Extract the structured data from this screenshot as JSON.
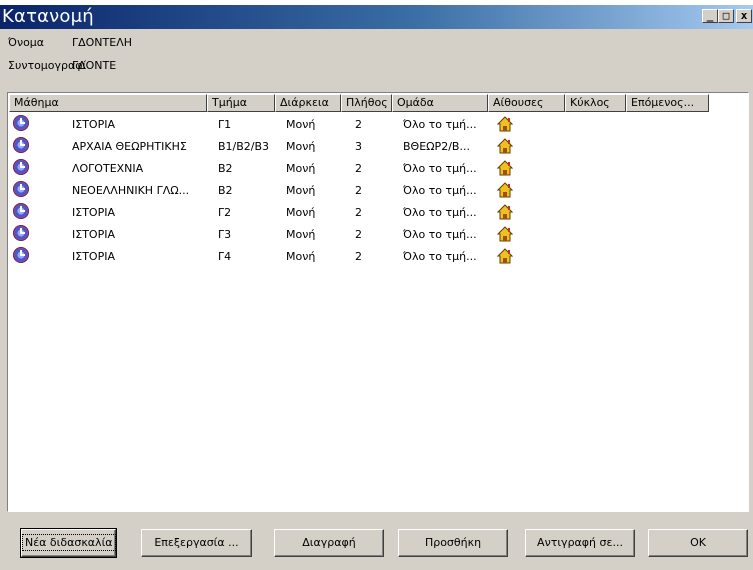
{
  "window": {
    "title": "Κατανομή",
    "controls": [
      "_",
      "□",
      "x"
    ]
  },
  "info": {
    "name_label": "Όνομα",
    "name_value": "ΓΔΟΝΤΕΛΗ",
    "abbr_label": "Συντομογραφί",
    "abbr_value": "ΓΔΟΝΤΕ"
  },
  "columns": [
    "Μάθημα",
    "Τμήμα",
    "Διάρκεια",
    "Πλήθος",
    "Ομάδα",
    "Αίθουσες",
    "Κύκλος",
    "Επόμενος..."
  ],
  "rows": [
    {
      "subject": "ΙΣΤΟΡΙΑ",
      "section": "Γ1",
      "duration": "Μονή",
      "count": "2",
      "group": "Όλο το τμή..."
    },
    {
      "subject": "ΑΡΧΑΙΑ ΘΕΩΡΗΤΙΚΗΣ",
      "section": "Β1/Β2/Β3",
      "duration": "Μονή",
      "count": "3",
      "group": "ΒΘΕΩΡ2/Β..."
    },
    {
      "subject": "ΛΟΓΟΤΕΧΝΙΑ",
      "section": "Β2",
      "duration": "Μονή",
      "count": "2",
      "group": "Όλο το τμή..."
    },
    {
      "subject": "ΝΕΟΕΛΛΗΝΙΚΗ ΓΛΩ...",
      "section": "Β2",
      "duration": "Μονή",
      "count": "2",
      "group": "Όλο το τμή..."
    },
    {
      "subject": "ΙΣΤΟΡΙΑ",
      "section": "Γ2",
      "duration": "Μονή",
      "count": "2",
      "group": "Όλο το τμή..."
    },
    {
      "subject": "ΙΣΤΟΡΙΑ",
      "section": "Γ3",
      "duration": "Μονή",
      "count": "2",
      "group": "Όλο το τμή..."
    },
    {
      "subject": "ΙΣΤΟΡΙΑ",
      "section": "Γ4",
      "duration": "Μονή",
      "count": "2",
      "group": "Όλο το τμή..."
    }
  ],
  "buttons": {
    "new_teaching": "Νέα διδασκαλία",
    "edit": "Επεξεργασία ...",
    "delete": "Διαγραφή",
    "add": "Προσθήκη",
    "copy_to": "Αντιγραφή σε...",
    "ok": "OK"
  },
  "colors": {
    "title_start": "#0a246a",
    "title_end": "#a6caf0",
    "face": "#d4d0c8"
  }
}
